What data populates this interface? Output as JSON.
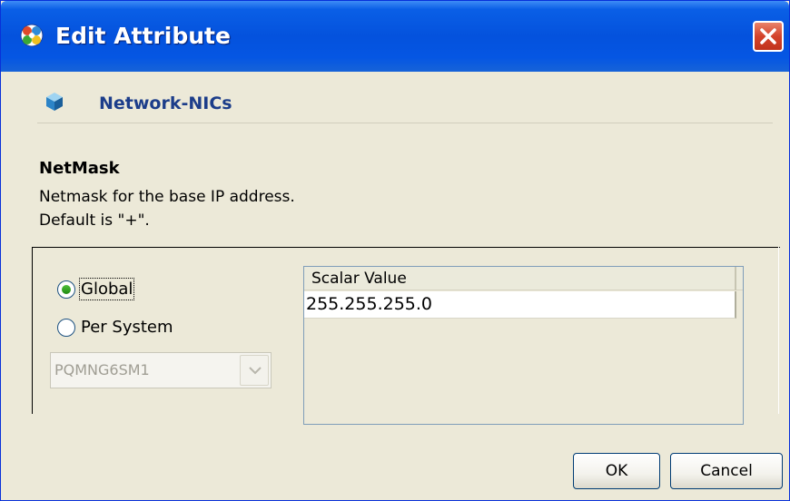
{
  "window": {
    "title": "Edit Attribute",
    "icons": {
      "app": "cluster-app-icon",
      "close": "close-icon"
    }
  },
  "header": {
    "section_name": "Network-NICs",
    "icon": "cube-icon"
  },
  "attribute": {
    "name": "NetMask",
    "description_line1": "Netmask for the base IP address.",
    "description_line2": "Default is \"+\"."
  },
  "scope": {
    "options": [
      {
        "label": "Global",
        "selected": true
      },
      {
        "label": "Per System",
        "selected": false
      }
    ],
    "system_combo": {
      "value": "PQMNG6SM1",
      "enabled": false
    }
  },
  "table": {
    "columns": [
      "Scalar Value"
    ],
    "rows": [
      [
        "255.255.255.0"
      ]
    ]
  },
  "buttons": {
    "ok": "OK",
    "cancel": "Cancel"
  },
  "colors": {
    "titlebar": "#0452dd",
    "dialog_bg": "#ece9d8",
    "section_name": "#1c3d8a",
    "close_button": "#d4432b"
  }
}
